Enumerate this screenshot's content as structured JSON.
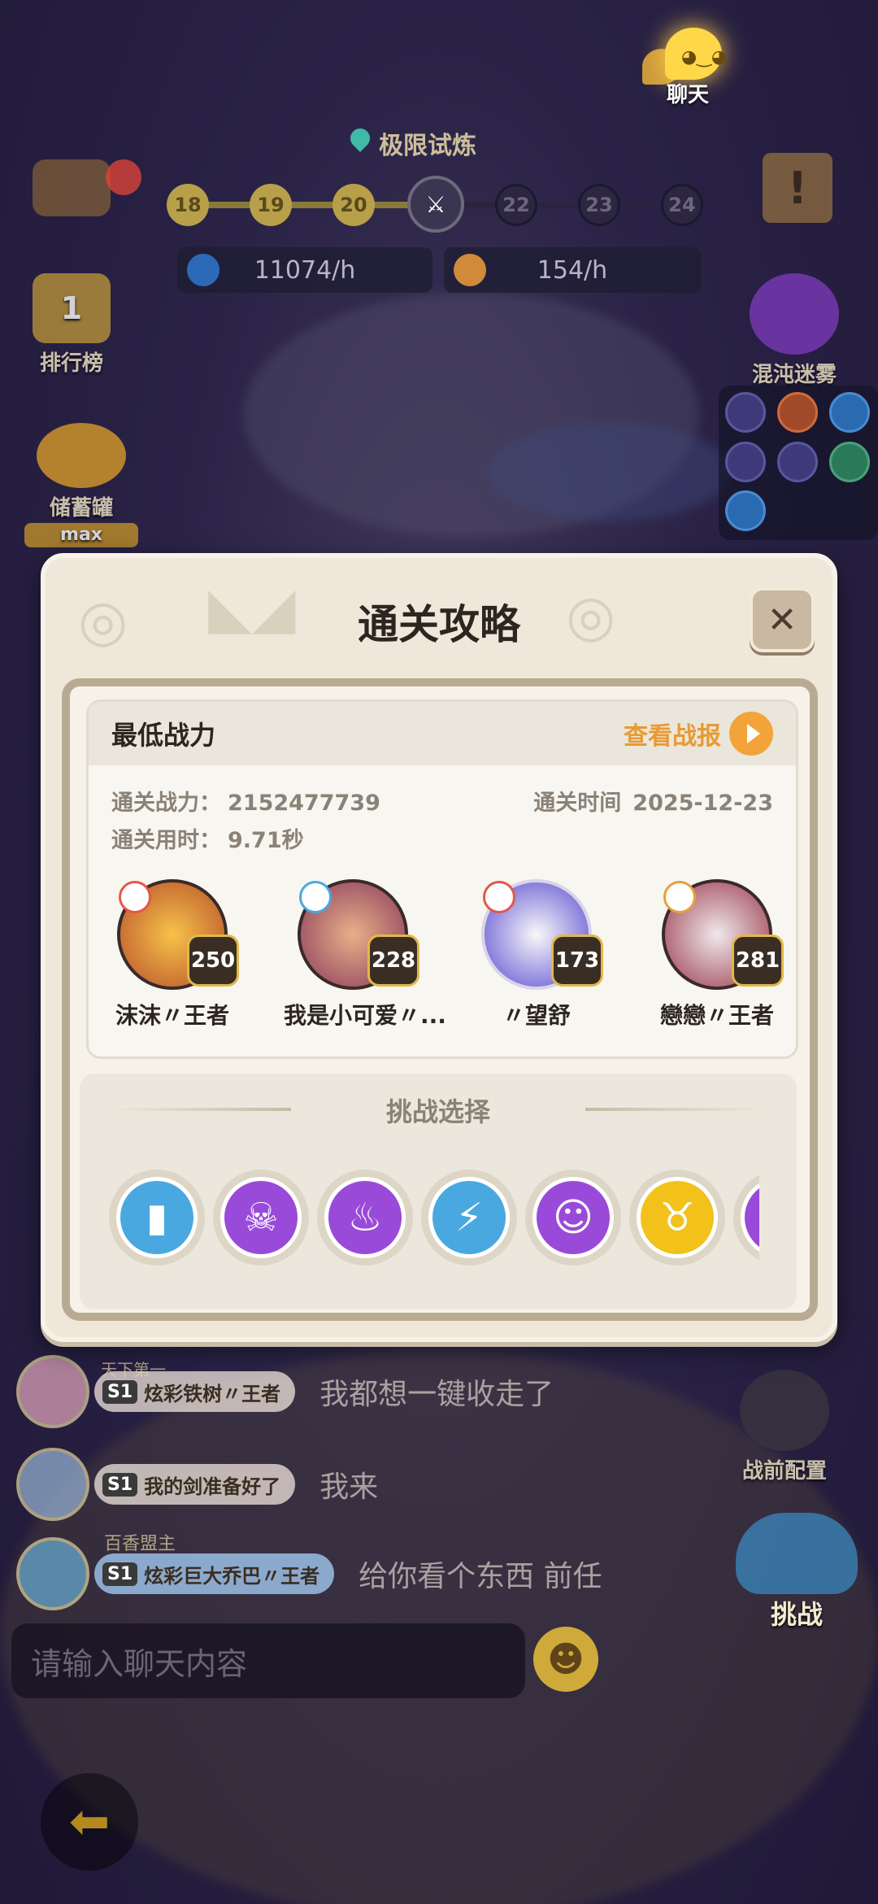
{
  "top_chat_button": {
    "label": "聊天",
    "face": "◕‿◕"
  },
  "stage": {
    "name": "极限试炼",
    "nodes": [
      "18",
      "19",
      "20",
      "",
      "22",
      "23",
      "24"
    ],
    "current_icon": "crossed-swords-icon"
  },
  "rates": {
    "moon": "11074/h",
    "coin": "154/h"
  },
  "side": {
    "ranking": "排行榜",
    "ranking_rank": "1",
    "piggy_bank": "储蓄罐",
    "piggy_level": "max",
    "chaos_fog": "混沌迷雾",
    "pre_battle": "战前配置",
    "challenge": "挑战"
  },
  "chat": {
    "messages": [
      {
        "title": "天下第一",
        "name": "炫彩铁树〃王者",
        "server": "S1",
        "text": "我都想一键收走了",
        "style": "plain"
      },
      {
        "title": "",
        "name": "我的剑准备好了",
        "server": "S1",
        "text": "我来",
        "style": "plain"
      },
      {
        "title": "百香盟主",
        "name": "炫彩巨大乔巴〃王者",
        "server": "S1",
        "text": "给你看个东西 前任",
        "style": "blue"
      }
    ],
    "input_placeholder": "请输入聊天内容",
    "emoji": "☻",
    "back_arrow": "⬅"
  },
  "modal": {
    "title": "通关攻略",
    "close": "✕",
    "card": {
      "header": "最低战力",
      "report_link": "查看战报",
      "power_label": "通关战力：",
      "power_value": "2152477739",
      "time_used_label": "通关用时：",
      "time_used_value": "9.71秒",
      "clear_date_label": "通关时间",
      "clear_date_value": "2025-12-23"
    },
    "heroes": [
      {
        "name": "沫沫〃王者",
        "level": "250",
        "color": "#f2a23a"
      },
      {
        "name": "我是小可爱〃...",
        "level": "228",
        "color": "#d98a6a"
      },
      {
        "name": "〃望舒",
        "level": "173",
        "color": "#6a5ad0"
      },
      {
        "name": "戀戀〃王者",
        "level": "281",
        "color": "#c8c8d8"
      }
    ],
    "choice_title": "挑战选择",
    "choices": [
      {
        "icon": "battery-icon",
        "glyph": "▮",
        "color": "#4aa8e0"
      },
      {
        "icon": "skull-icon",
        "glyph": "☠",
        "color": "#9a4ad8"
      },
      {
        "icon": "flame-icon",
        "glyph": "♨",
        "color": "#9a4ad8"
      },
      {
        "icon": "lightning-icon",
        "glyph": "⚡",
        "color": "#4aa8e0"
      },
      {
        "icon": "ghost-icon",
        "glyph": "☺",
        "color": "#9a4ad8"
      },
      {
        "icon": "pig-icon",
        "glyph": "♉",
        "color": "#f2c21a"
      },
      {
        "icon": "partial-icon",
        "glyph": "▣",
        "color": "#9a4ad8"
      }
    ]
  }
}
